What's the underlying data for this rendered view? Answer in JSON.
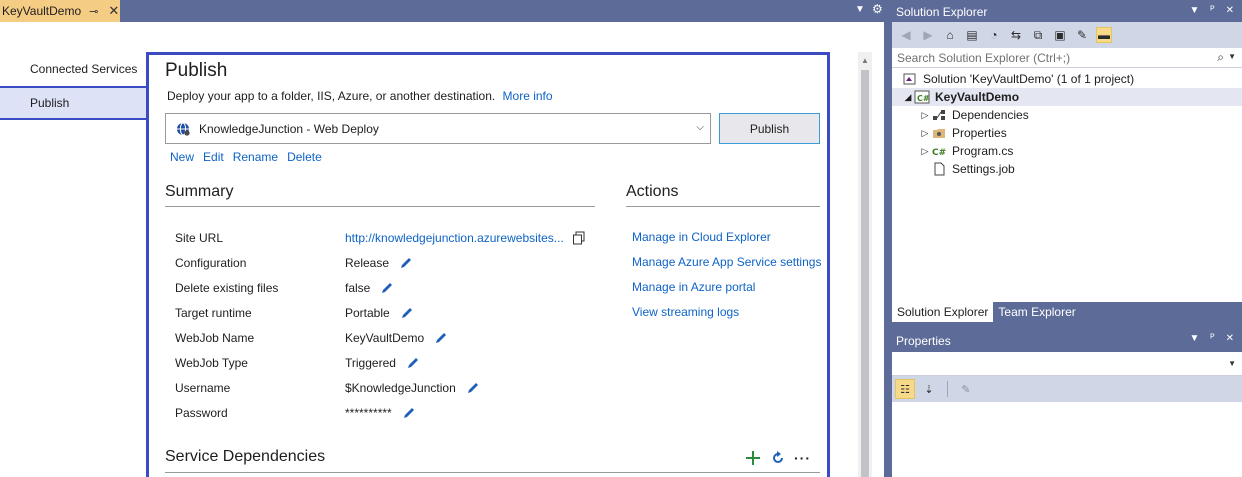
{
  "document_tab": {
    "title": "KeyVaultDemo",
    "pin": "⊸",
    "close": "✕"
  },
  "nav": {
    "items": [
      {
        "label": "Connected Services",
        "active": false
      },
      {
        "label": "Publish",
        "active": true
      }
    ]
  },
  "publish": {
    "title": "Publish",
    "description": "Deploy your app to a folder, IIS, Azure, or another destination.",
    "more_info": "More info",
    "profile": "KnowledgeJunction - Web Deploy",
    "publish_button": "Publish",
    "profile_actions": [
      "New",
      "Edit",
      "Rename",
      "Delete"
    ]
  },
  "summary": {
    "title": "Summary",
    "rows": [
      {
        "label": "Site URL",
        "value": "http://knowledgejunction.azurewebsites...",
        "link": true
      },
      {
        "label": "Configuration",
        "value": "Release"
      },
      {
        "label": "Delete existing files",
        "value": "false"
      },
      {
        "label": "Target runtime",
        "value": "Portable"
      },
      {
        "label": "WebJob Name",
        "value": "KeyVaultDemo"
      },
      {
        "label": "WebJob Type",
        "value": "Triggered"
      },
      {
        "label": "Username",
        "value": "$KnowledgeJunction"
      },
      {
        "label": "Password",
        "value": "**********"
      }
    ]
  },
  "actions": {
    "title": "Actions",
    "links": [
      "Manage in Cloud Explorer",
      "Manage Azure App Service settings",
      "Manage in Azure portal",
      "View streaming logs"
    ]
  },
  "service_dependencies": {
    "title": "Service Dependencies",
    "more": "···"
  },
  "solution_explorer": {
    "title": "Solution Explorer",
    "search_placeholder": "Search Solution Explorer (Ctrl+;)",
    "tree": [
      {
        "label": "Solution 'KeyVaultDemo' (1 of 1 project)",
        "icon": "solution-icon",
        "arrow": ""
      },
      {
        "label": "KeyVaultDemo",
        "icon": "csharp-project-icon",
        "arrow": "◢",
        "bold": true,
        "selected": true
      },
      {
        "label": "Dependencies",
        "icon": "dependencies-icon",
        "arrow": "▷"
      },
      {
        "label": "Properties",
        "icon": "properties-folder-icon",
        "arrow": "▷"
      },
      {
        "label": "Program.cs",
        "icon": "csharp-file-icon",
        "arrow": "▷"
      },
      {
        "label": "Settings.job",
        "icon": "file-icon",
        "arrow": ""
      }
    ],
    "tabs": [
      {
        "label": "Solution Explorer",
        "active": true
      },
      {
        "label": "Team Explorer",
        "active": false
      }
    ]
  },
  "properties": {
    "title": "Properties"
  },
  "colors": {
    "accent": "#3b4bc2",
    "link": "#0e63c7",
    "chrome": "#5d6b99",
    "tab_active": "#f5cc84"
  }
}
